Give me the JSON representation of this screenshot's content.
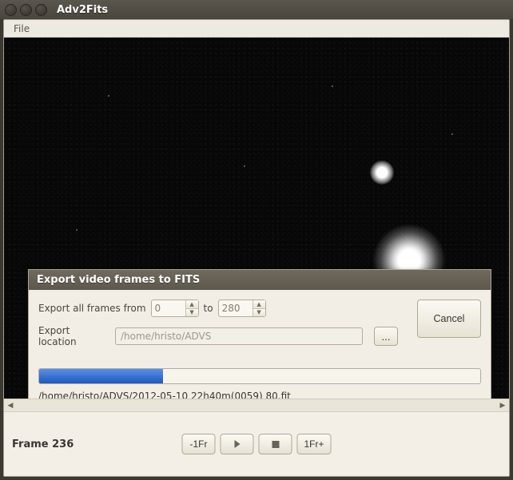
{
  "window": {
    "title": "Adv2Fits"
  },
  "menu": {
    "file": "File"
  },
  "dialog": {
    "title": "Export video frames to FITS",
    "from_label": "Export all frames from",
    "to_label": "to",
    "from_value": "0",
    "to_value": "280",
    "location_label": "Export location",
    "location_value": "/home/hristo/ADVS",
    "browse_label": "...",
    "cancel_label": "Cancel",
    "progress_percent": 28,
    "status_text": "/home/hristo/ADVS/2012-05-10 22h40m(0059)  80.fit"
  },
  "footer": {
    "frame_label": "Frame 236",
    "btn_prev": "-1Fr",
    "btn_next": "1Fr+"
  },
  "icons": {
    "spin_up": "▲",
    "spin_down": "▼",
    "scroll_left": "◀",
    "scroll_right": "▶"
  }
}
